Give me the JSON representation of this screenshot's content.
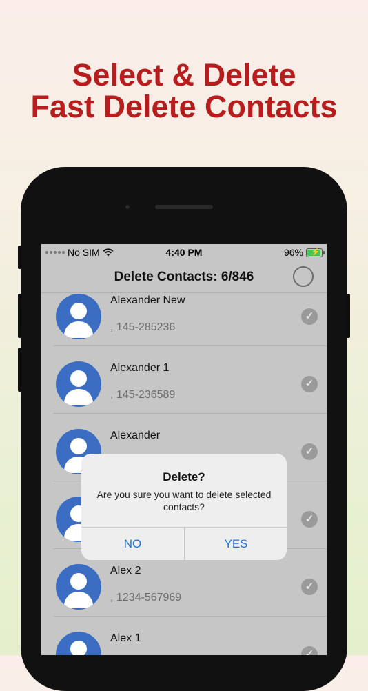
{
  "headline": {
    "line1": "Select & Delete",
    "line2": "Fast Delete Contacts"
  },
  "status_bar": {
    "carrier": "No SIM",
    "time": "4:40 PM",
    "battery": "96%"
  },
  "nav": {
    "title": "Delete Contacts: 6/846"
  },
  "contacts": [
    {
      "name": "Alexander New",
      "phone": ", 145-285236"
    },
    {
      "name": "Alexander 1",
      "phone": ", 145-236589"
    },
    {
      "name": "Alexander",
      "phone": ""
    },
    {
      "name": "",
      "phone": ""
    },
    {
      "name": "Alex 2",
      "phone": ", 1234-567969"
    },
    {
      "name": "Alex 1",
      "phone": ""
    }
  ],
  "alert": {
    "title": "Delete?",
    "message": "Are you sure you want to delete selected contacts?",
    "no_label": "NO",
    "yes_label": "YES"
  },
  "colors": {
    "headline": "#b81d1d",
    "avatar": "#3b6ec2",
    "alert_button": "#1a72e6"
  },
  "icons": {
    "avatar": "person-icon",
    "check": "checkmark-icon",
    "wifi": "wifi-icon",
    "battery": "battery-charging-icon"
  }
}
